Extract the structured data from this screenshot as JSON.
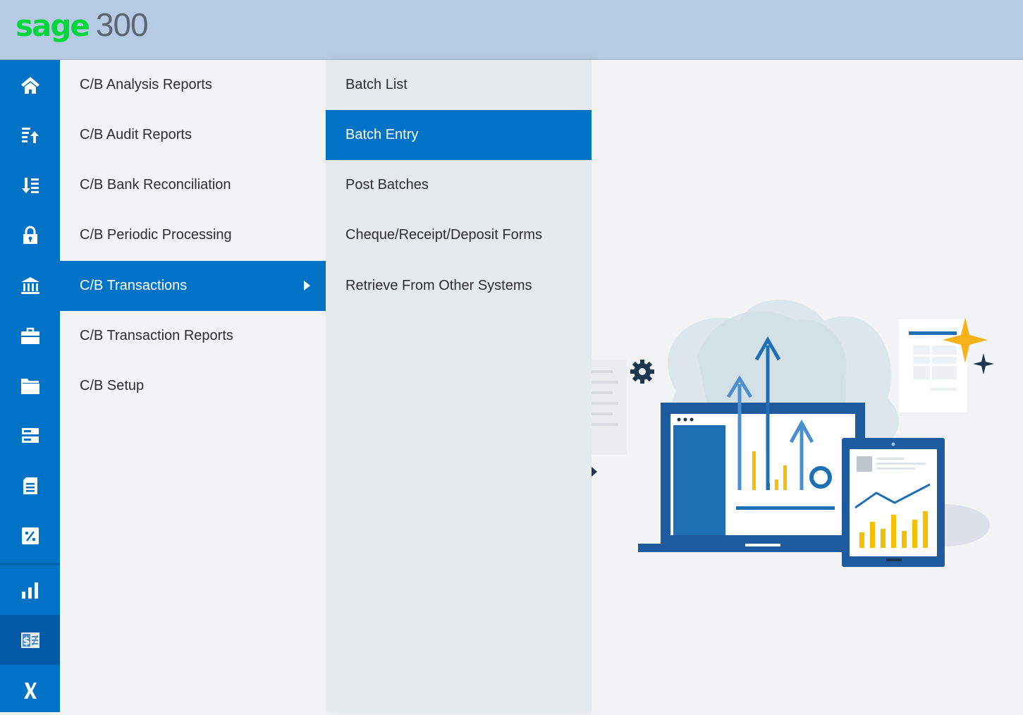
{
  "header": {
    "logo_brand": "sage",
    "logo_product": "300"
  },
  "rail": {
    "items": [
      {
        "icon": "home-icon"
      },
      {
        "icon": "sort-list-up-icon"
      },
      {
        "icon": "sort-list-down-icon"
      },
      {
        "icon": "lock-icon"
      },
      {
        "icon": "bank-icon"
      },
      {
        "icon": "briefcase-icon"
      },
      {
        "icon": "folder-icon"
      },
      {
        "icon": "server-icon"
      },
      {
        "icon": "document-icon"
      },
      {
        "icon": "percent-icon"
      },
      {
        "icon": "bar-chart-icon"
      },
      {
        "icon": "cash-book-icon",
        "active": true
      },
      {
        "icon": "tools-icon"
      }
    ]
  },
  "menu": {
    "items": [
      {
        "label": "C/B Analysis Reports"
      },
      {
        "label": "C/B Audit Reports"
      },
      {
        "label": "C/B Bank Reconciliation"
      },
      {
        "label": "C/B Periodic Processing"
      },
      {
        "label": "C/B Transactions",
        "selected": true
      },
      {
        "label": "C/B Transaction Reports"
      },
      {
        "label": "C/B Setup"
      }
    ]
  },
  "submenu": {
    "items": [
      {
        "label": "Batch List"
      },
      {
        "label": "Batch Entry",
        "selected": true
      },
      {
        "label": "Post Batches"
      },
      {
        "label": "Cheque/Receipt/Deposit Forms"
      },
      {
        "label": "Retrieve From Other Systems"
      }
    ]
  },
  "colors": {
    "accent": "#0073c6",
    "header": "#b6cbe3",
    "brand_green": "#00d639",
    "rail_active": "#005aa6"
  }
}
